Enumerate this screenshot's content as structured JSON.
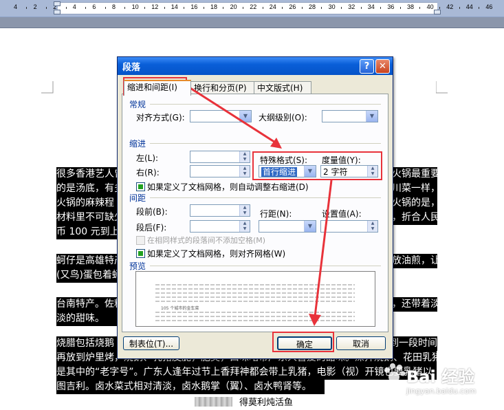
{
  "ruler": {
    "numbers": [
      "4",
      "2",
      "2",
      "4",
      "6",
      "8",
      "10",
      "12",
      "14",
      "16",
      "18",
      "20",
      "22",
      "24",
      "26",
      "28",
      "30",
      "32",
      "34",
      "36",
      "38",
      "40",
      "42",
      "44",
      "46"
    ]
  },
  "document": {
    "lines": [
      "很多香港艺人曾",
      "的是汤底，有多",
      "火锅的麻辣程",
      "材料里不可缺少",
      "币 100 元到上",
      "蚵仔是高雄特产",
      "(又鸟)蛋包着蚵",
      "台南特产。佐料",
      "淡的甜味。",
      "烧腊包括烧鹅",
      "再放到炉里烤，烧鹅、乳猪皮脆，肥美，口味略带广东人喜爱的甜味。深井烧鹅、花田乳猪",
      "是其中的“老字号”。广东人逢年过节上香拜神都会带上乳猪，电影（视）开镜也要乳猪以",
      "图吉利。卤水菜式相对清淡，卤水鹅掌（翼）、卤水鸭肾等。"
    ],
    "right_lines": [
      "火锅最重要",
      "川菜一样，",
      "火锅的是，",
      "，折合人民",
      "放油煎，让",
      "，还带着淡",
      "到一段时间"
    ],
    "caption": "得莫利炖活鱼"
  },
  "dialog": {
    "title": "段落",
    "help": "?",
    "close": "✕",
    "tabs": [
      "缩进和间距(I)",
      "换行和分页(P)",
      "中文版式(H)"
    ],
    "general": {
      "heading": "常规",
      "alignment_label": "对齐方式(G):",
      "outline_label": "大纲级别(O):"
    },
    "indent": {
      "heading": "缩进",
      "left_label": "左(L):",
      "right_label": "右(R):",
      "special_label": "特殊格式(S):",
      "special_value": "首行缩进",
      "by_label": "度量值(Y):",
      "by_value": "2 字符",
      "auto_adjust": "如果定义了文档网格，则自动调整右缩进(D)"
    },
    "spacing": {
      "heading": "间距",
      "before_label": "段前(B):",
      "after_label": "段后(F):",
      "line_label": "行距(N):",
      "at_label": "设置值(A):",
      "no_space": "在相同样式的段落间不添加空格(M)",
      "snap_grid": "如果定义了文档网格，则对齐网格(W)"
    },
    "preview": {
      "heading": "预览",
      "sample": "105 个城市的金车菜"
    },
    "buttons": {
      "tabs": "制表位(T)...",
      "ok": "确定",
      "cancel": "取消"
    }
  },
  "watermark": {
    "main": "Bai 经验",
    "url": "jingyan.baidu.com"
  },
  "colors": {
    "titlebar": "#0553c8",
    "dialog_bg": "#ece9d8",
    "highlight": "#e8323a",
    "selection": "#316ac5"
  }
}
